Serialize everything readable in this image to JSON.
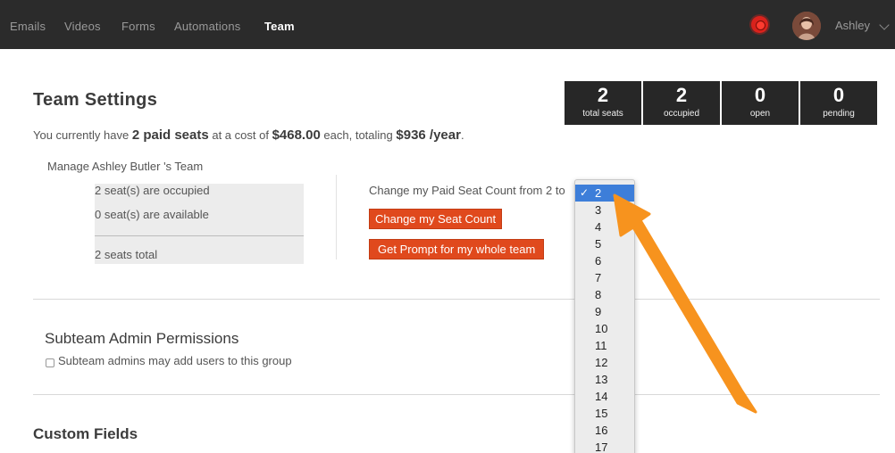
{
  "nav": {
    "items": [
      "Emails",
      "Videos",
      "Forms",
      "Automations",
      "Team"
    ],
    "active": "Team"
  },
  "user": {
    "name": "Ashley",
    "icon": "chevron-down-icon"
  },
  "page": {
    "title": "Team Settings",
    "summary": {
      "prefix": "You currently have",
      "seats": "2 paid seats",
      "mid1": "at a cost of",
      "cost": "$468.00",
      "mid2": "each, totaling",
      "total": "$936 /year",
      "suffix": "."
    }
  },
  "stats": [
    {
      "num": "2",
      "label": "total seats"
    },
    {
      "num": "2",
      "label": "occupied"
    },
    {
      "num": "0",
      "label": "open"
    },
    {
      "num": "0",
      "label": "pending"
    }
  ],
  "manage": {
    "title": "Manage Ashley Butler 's Team",
    "occupied": "2 seat(s) are occupied",
    "available": "0 seat(s) are available",
    "total": "2 seats total"
  },
  "seat_change": {
    "label": "Change my Paid Seat Count from 2 to",
    "change_button": "Change my Seat Count",
    "prompt_button": "Get Prompt for my whole team"
  },
  "dropdown": {
    "selected": "2",
    "options": [
      "2",
      "3",
      "4",
      "5",
      "6",
      "7",
      "8",
      "9",
      "10",
      "11",
      "12",
      "13",
      "14",
      "15",
      "16",
      "17"
    ]
  },
  "subteam": {
    "title": "Subteam Admin Permissions",
    "checkbox_label": "Subteam admins may add users to this group"
  },
  "custom_fields": {
    "title": "Custom Fields"
  },
  "colors": {
    "accent": "#e0491d",
    "topbar": "#2b2b2b",
    "arrow": "#f7931e",
    "selection": "#3d7ed9"
  }
}
